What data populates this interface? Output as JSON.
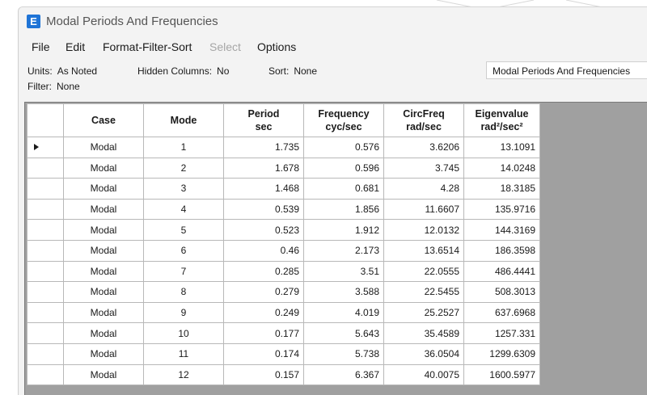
{
  "window": {
    "title": "Modal Periods And Frequencies",
    "icon_letter": "E"
  },
  "menu": {
    "items": [
      {
        "label": "File",
        "enabled": true
      },
      {
        "label": "Edit",
        "enabled": true
      },
      {
        "label": "Format-Filter-Sort",
        "enabled": true
      },
      {
        "label": "Select",
        "enabled": false
      },
      {
        "label": "Options",
        "enabled": true
      }
    ]
  },
  "info": {
    "units_label": "Units:",
    "units_value": "As Noted",
    "hidden_label": "Hidden Columns:",
    "hidden_value": "No",
    "sort_label": "Sort:",
    "sort_value": "None",
    "filter_label": "Filter:",
    "filter_value": "None",
    "table_name": "Modal Periods And Frequencies"
  },
  "table": {
    "columns": [
      {
        "line1": "Case",
        "line2": ""
      },
      {
        "line1": "Mode",
        "line2": ""
      },
      {
        "line1": "Period",
        "line2": "sec"
      },
      {
        "line1": "Frequency",
        "line2": "cyc/sec"
      },
      {
        "line1": "CircFreq",
        "line2": "rad/sec"
      },
      {
        "line1": "Eigenvalue",
        "line2": "rad²/sec²"
      }
    ],
    "rows": [
      [
        "Modal",
        "1",
        "1.735",
        "0.576",
        "3.6206",
        "13.1091"
      ],
      [
        "Modal",
        "2",
        "1.678",
        "0.596",
        "3.745",
        "14.0248"
      ],
      [
        "Modal",
        "3",
        "1.468",
        "0.681",
        "4.28",
        "18.3185"
      ],
      [
        "Modal",
        "4",
        "0.539",
        "1.856",
        "11.6607",
        "135.9716"
      ],
      [
        "Modal",
        "5",
        "0.523",
        "1.912",
        "12.0132",
        "144.3169"
      ],
      [
        "Modal",
        "6",
        "0.46",
        "2.173",
        "13.6514",
        "186.3598"
      ],
      [
        "Modal",
        "7",
        "0.285",
        "3.51",
        "22.0555",
        "486.4441"
      ],
      [
        "Modal",
        "8",
        "0.279",
        "3.588",
        "22.5455",
        "508.3013"
      ],
      [
        "Modal",
        "9",
        "0.249",
        "4.019",
        "25.2527",
        "637.6968"
      ],
      [
        "Modal",
        "10",
        "0.177",
        "5.643",
        "35.4589",
        "1257.331"
      ],
      [
        "Modal",
        "11",
        "0.174",
        "5.738",
        "36.0504",
        "1299.6309"
      ],
      [
        "Modal",
        "12",
        "0.157",
        "6.367",
        "40.0075",
        "1600.5977"
      ]
    ],
    "current_row": 0
  }
}
